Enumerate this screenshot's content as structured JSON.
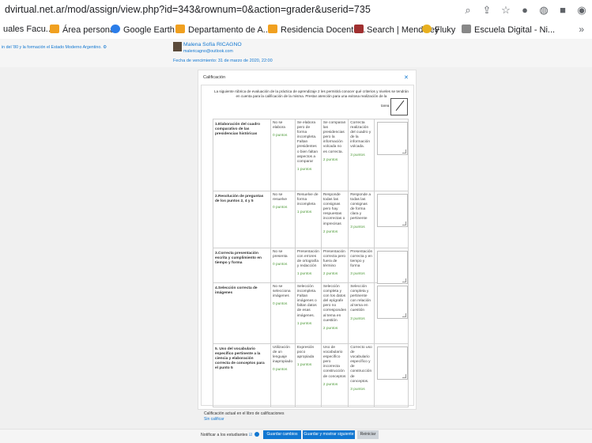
{
  "browser": {
    "url": "dvirtual.net.ar/mod/assign/view.php?id=343&rownum=0&action=grader&userid=735",
    "bookmarks": [
      "uales Facu...",
      "Área personal",
      "Google Earth",
      "Departamento de A...",
      "Residencia Docente...",
      "Search | Mendeley",
      "Fluky",
      "Escuela Digital - Ni..."
    ],
    "more": "»"
  },
  "header": {
    "course": "in del '80 y la formación el Estado Moderno Argentino.",
    "student_name": "Malena Sofía RICAGNO",
    "student_email": "malericagno@outlook.com",
    "due_date": "Fecha de vencimiento: 31 de marzo de 2020, 22:00"
  },
  "grading": {
    "title": "Calificación",
    "close": "✕",
    "intro": "La siguiente rúbrica de evaluación de la práctica de aprendizaje 2 les permitirá conocer qué criterios y niveles se tendrán en cuenta para la calificación de la misma. Prestar atención para una exitosa realización de la",
    "tarea_label": "tarea.",
    "criteria": [
      {
        "title": "1.Elaboración del cuadro comparativo de las presidencias históricas",
        "levels": [
          {
            "text": "No se elabora",
            "points": "0 puntos"
          },
          {
            "text": "Se elabora pero de forma incompleta. Faltan presidentes o bien faltan aspectos a comparar",
            "points": "1 puntos"
          },
          {
            "text": "Se comparan las presidencias pero la información volcada no es correcta.",
            "points": "2 puntos"
          },
          {
            "text": "Correcta realización del cuadro y de la información volcada.",
            "points": "3 puntos"
          }
        ]
      },
      {
        "title": "2.Resolución de preguntas de los puntos 2, 4 y 5",
        "levels": [
          {
            "text": "No se resuelve",
            "points": "0 puntos"
          },
          {
            "text": "Resuelve de forma incompleta",
            "points": "1 puntos"
          },
          {
            "text": "Responde todas las consignas pero hay respuestas incorrectas o imprecisas",
            "points": "2 puntos"
          },
          {
            "text": "Responde a todas las consignas de forma clara y pertinente",
            "points": "3 puntos"
          }
        ]
      },
      {
        "title": "3.Correcta presentación escrita y cumplimiento en tiempo y forma",
        "levels": [
          {
            "text": "No se presenta",
            "points": "0 puntos"
          },
          {
            "text": "Presentación con errores de ortografía y redacción",
            "points": "1 puntos"
          },
          {
            "text": "Presentación correcta pero fuera de término",
            "points": "2 puntos"
          },
          {
            "text": "Presentación correcta y en tiempo y forma",
            "points": "3 puntos"
          }
        ]
      },
      {
        "title": "4.Selección correcta de imágenes",
        "levels": [
          {
            "text": "No se selecciona imágenes",
            "points": "0 puntos"
          },
          {
            "text": "Selección incompleta. Faltan imágenes o faltan datos de esas imágenes.",
            "points": "1 puntos"
          },
          {
            "text": "Selección completa y con los datos del epígrafe pero no corresponden al tema en cuestión",
            "points": "2 puntos"
          },
          {
            "text": "Selección completa y pertinente con relación al tema en cuestión",
            "points": "3 puntos"
          }
        ]
      },
      {
        "title": "5. Uso del vocabulario específico pertinente a la ciencia y elaboración correcta de conceptos para el punto 5",
        "levels": [
          {
            "text": "Utilización de un lenguaje inapropiado",
            "points": "0 puntos"
          },
          {
            "text": "Expresión poco apropiada",
            "points": "1 puntos"
          },
          {
            "text": "Uso de vocabulario específico pero incorrecta construcción de conceptos",
            "points": "2 puntos"
          },
          {
            "text": "Correcto uso de vocabulario específico y de construcción de conceptos.",
            "points": "3 puntos"
          }
        ]
      }
    ],
    "current_grade_label": "Calificación actual en el libro de calificaciones",
    "current_grade_value": "Sin calificar"
  },
  "footer": {
    "notify_label": "Notificar a los estudiantes",
    "save": "Guardar cambios",
    "save_next": "Guardar y mostrar siguiente",
    "reset": "Reiniciar"
  }
}
